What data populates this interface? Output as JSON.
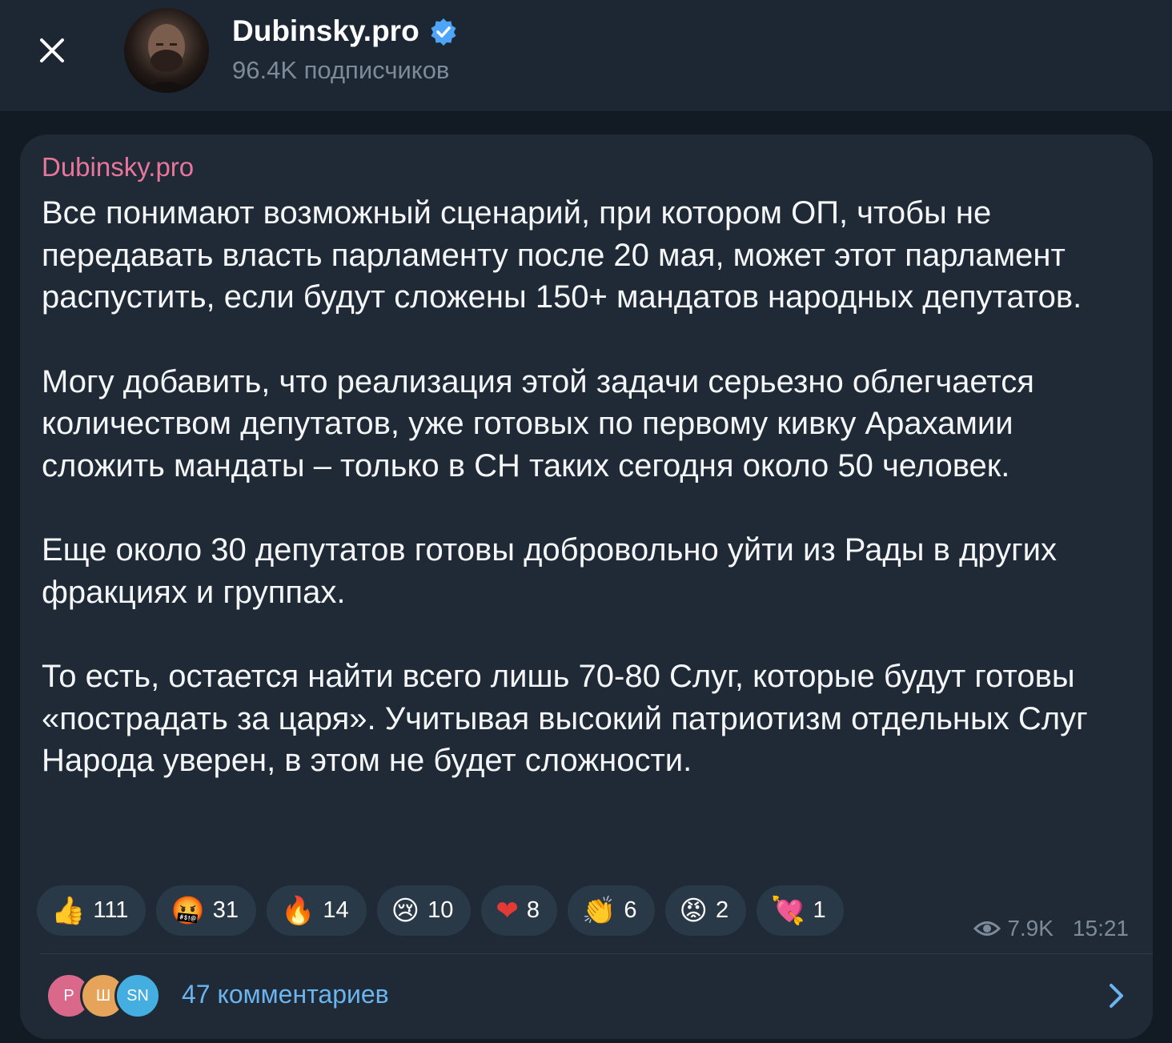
{
  "header": {
    "channel_name": "Dubinsky.pro",
    "subscribers": "96.4K подписчиков"
  },
  "post": {
    "author": "Dubinsky.pro",
    "paragraphs": [
      "Все понимают возможный сценарий, при котором ОП, чтобы не передавать власть парламенту после 20 мая, может этот парламент распустить, если будут сложены 150+ мандатов народных депутатов.",
      "Могу добавить, что реализация этой задачи серьезно облегчается количеством депутатов, уже готовых по первому кивку Арахамии сложить мандаты – только в СН таких сегодня около 50 человек.",
      "Еще около 30 депутатов готовы добровольно уйти из Рады в других фракциях и группах.",
      "То есть, остается найти всего лишь 70-80 Слуг, которые будут готовы «пострадать за царя». Учитывая высокий патриотизм отдельных Слуг Народа уверен, в этом не будет сложности."
    ],
    "reactions": [
      {
        "emoji": "👍",
        "icon": "thumbs-up-icon",
        "count": "111"
      },
      {
        "emoji": "🤬",
        "icon": "cursing-face-icon",
        "count": "31"
      },
      {
        "emoji": "🔥",
        "icon": "fire-icon",
        "count": "14"
      },
      {
        "emoji": "😢",
        "icon": "crying-face-icon",
        "count": "10"
      },
      {
        "emoji": "❤",
        "icon": "heart-icon",
        "count": "8"
      },
      {
        "emoji": "👏",
        "icon": "clapping-hands-icon",
        "count": "6"
      },
      {
        "emoji": "😡",
        "icon": "angry-face-icon",
        "count": "2"
      },
      {
        "emoji": "💘",
        "icon": "heart-arrow-icon",
        "count": "1"
      }
    ],
    "views": "7.9K",
    "time": "15:21"
  },
  "comments": {
    "avatars": [
      "Р",
      "Ш",
      "SN"
    ],
    "label": "47 комментариев"
  },
  "colors": {
    "accent": "#6ab4ef",
    "author": "#e8769a",
    "bubble": "#1f2a36",
    "verified": "#4ea4f6"
  }
}
